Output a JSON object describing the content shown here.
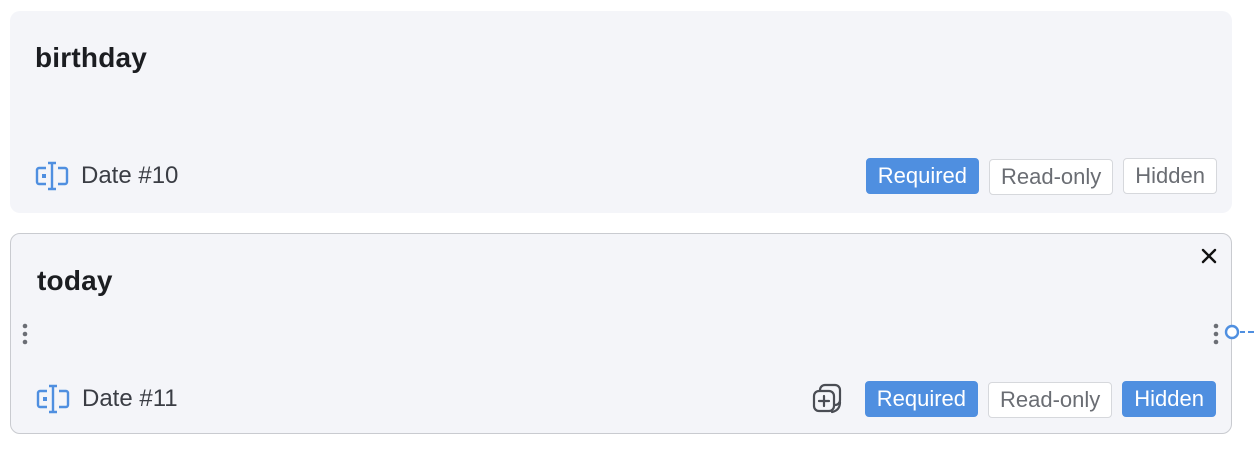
{
  "fields": [
    {
      "title": "birthday",
      "type_label": "Date #10",
      "type_icon": "text-cursor-field-icon",
      "flags": {
        "required": "Required",
        "readonly": "Read-only",
        "hidden": "Hidden"
      },
      "state": {
        "required": true,
        "readonly": false,
        "hidden": false
      }
    },
    {
      "title": "today",
      "type_label": "Date #11",
      "type_icon": "text-cursor-field-icon",
      "flags": {
        "required": "Required",
        "readonly": "Read-only",
        "hidden": "Hidden"
      },
      "state": {
        "required": true,
        "readonly": false,
        "hidden": true
      },
      "selected": true
    }
  ],
  "icons": {
    "close": "close-icon",
    "duplicate": "duplicate-icon",
    "drag": "drag-handle-icon",
    "connector": "connection-port-icon"
  },
  "colors": {
    "accent": "#4f8fe0",
    "card_bg": "#f4f5f9",
    "selected_border": "#c9cbd0",
    "text": "#1b1d21"
  }
}
